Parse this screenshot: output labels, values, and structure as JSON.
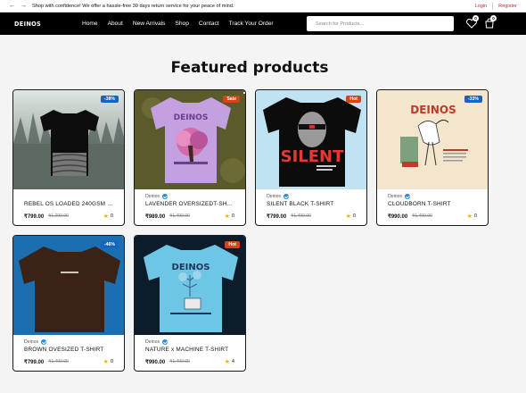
{
  "announcement": {
    "text": "Shop with confidence! We offer a hassle-free 30 days return service for your peace of mind.",
    "login": "Login",
    "register": "Register"
  },
  "brand": {
    "logo": "DEINOS"
  },
  "nav": {
    "items": [
      "Home",
      "About",
      "New Arrivals",
      "Shop",
      "Contact",
      "Track Your Order"
    ]
  },
  "search": {
    "placeholder": "Search for Products..."
  },
  "header_icons": {
    "wishlist_count": "0",
    "cart_count": "0"
  },
  "section": {
    "title": "Featured products"
  },
  "products": [
    {
      "brand": "",
      "name": "REBEL OS LOADED 240GSM OVE...",
      "price": "₹799.00",
      "mrp": "₹1,299.00",
      "rating": "0",
      "tag": "-38%"
    },
    {
      "brand": "Deinos",
      "name": "LAVENDER OVERSIZEDT-SHIRT",
      "price": "₹989.00",
      "mrp": "₹1,499.00",
      "rating": "0",
      "tag": "Sale",
      "print": "DEINOS"
    },
    {
      "brand": "Deinos",
      "name": "SILENT BLACK T-SHIRT",
      "price": "₹799.00",
      "mrp": "₹1,499.00",
      "rating": "0",
      "tag": "Hot",
      "print": "SILENT"
    },
    {
      "brand": "Deinos",
      "name": "CLOUDBORN T-SHIRT",
      "price": "₹990.00",
      "mrp": "₹1,499.00",
      "rating": "0",
      "tag": "-33%",
      "print": "DEINOS"
    },
    {
      "brand": "Deinos",
      "name": "BROWN OVESIZED T-SHIRT",
      "price": "₹799.00",
      "mrp": "₹1,499.00",
      "rating": "0",
      "tag": "-46%"
    },
    {
      "brand": "Deinos",
      "name": "NATURE x MACHINE T-SHIRT",
      "price": "₹990.00",
      "mrp": "₹1,499.00",
      "rating": "4",
      "tag": "Hot",
      "print": "DEINOS"
    }
  ],
  "colors": {
    "accent_red": "#d84315",
    "discount_blue": "#1565c0",
    "verified_blue": "#1e88e5",
    "star": "#f4b400"
  }
}
